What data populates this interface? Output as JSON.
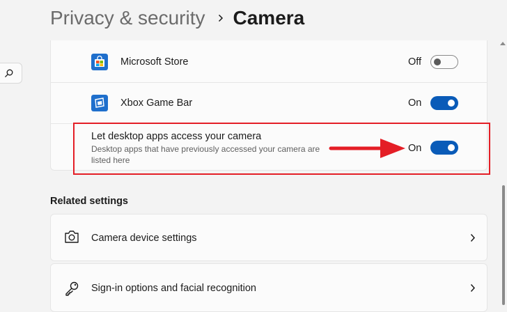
{
  "breadcrumb": {
    "parent": "Privacy & security",
    "current": "Camera"
  },
  "apps": [
    {
      "name": "Microsoft Store",
      "state_label": "Off",
      "enabled": false,
      "icon": "microsoft-store-icon"
    },
    {
      "name": "Xbox Game Bar",
      "state_label": "On",
      "enabled": true,
      "icon": "xbox-game-bar-icon"
    }
  ],
  "desktop_apps": {
    "title": "Let desktop apps access your camera",
    "description": "Desktop apps that have previously accessed your camera are listed here",
    "state_label": "On",
    "enabled": true
  },
  "related": {
    "heading": "Related settings",
    "items": [
      {
        "label": "Camera device settings",
        "icon": "camera-icon"
      },
      {
        "label": "Sign-in options and facial recognition",
        "icon": "key-icon"
      }
    ]
  },
  "colors": {
    "accent": "#0a5bb8",
    "annotation": "#e41e26",
    "background": "#f3f3f3",
    "card": "#fbfbfb"
  }
}
